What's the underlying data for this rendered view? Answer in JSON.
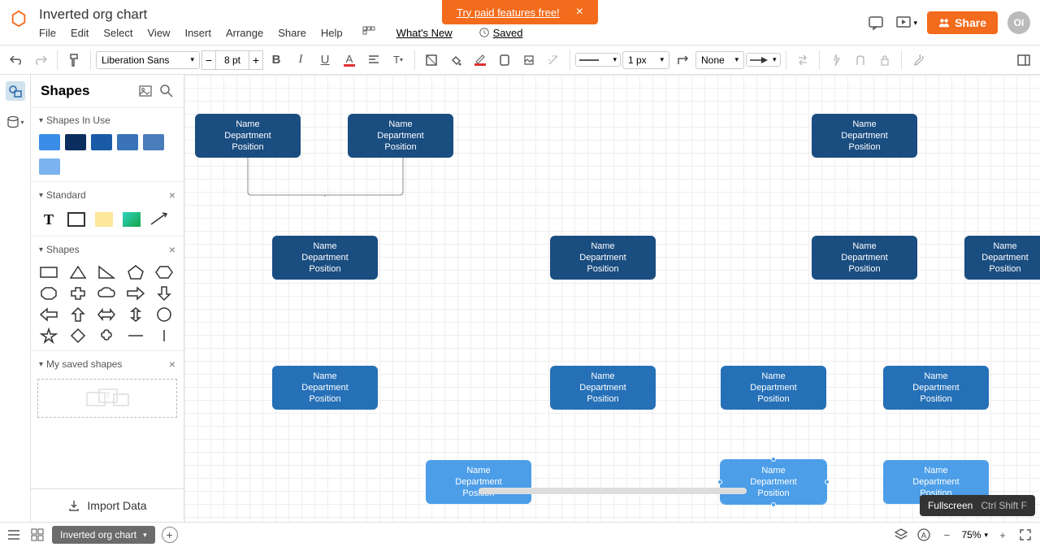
{
  "promo": {
    "text": "Try paid features free!"
  },
  "doc": {
    "title": "Inverted org chart"
  },
  "menus": [
    "File",
    "Edit",
    "Select",
    "View",
    "Insert",
    "Arrange",
    "Share",
    "Help"
  ],
  "whatsNew": "What's New",
  "saved": "Saved",
  "share": "Share",
  "avatar": "OI",
  "toolbar": {
    "font": "Liberation Sans",
    "fontSize": "8 pt",
    "lineWidth": "1 px",
    "end": "None"
  },
  "sidebar": {
    "title": "Shapes",
    "sections": {
      "inUse": "Shapes In Use",
      "standard": "Standard",
      "shapes": "Shapes",
      "saved": "My saved shapes"
    },
    "import": "Import Data"
  },
  "node": {
    "line1": "Name",
    "line2": "Department",
    "line3": "Position"
  },
  "bottom": {
    "pageTab": "Inverted org chart",
    "zoom": "75%"
  },
  "tooltip": {
    "label": "Fullscreen",
    "shortcut": "Ctrl Shift F"
  }
}
